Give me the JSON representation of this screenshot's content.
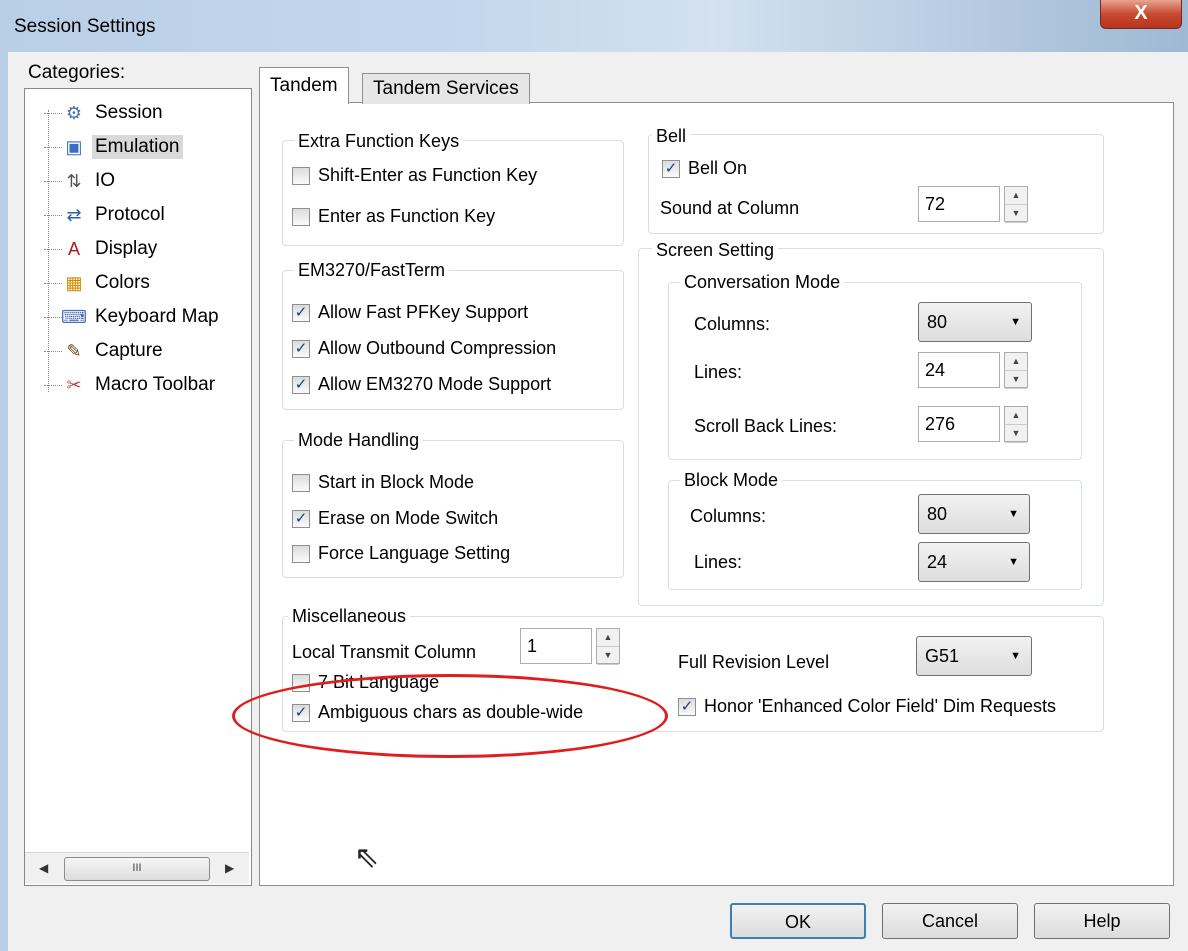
{
  "window": {
    "title": "Session Settings",
    "close_glyph": "X"
  },
  "categories": {
    "label": "Categories:",
    "items": [
      {
        "label": "Session",
        "icon": "session-icon",
        "glyph": "⚙",
        "color": "#4a6fb5"
      },
      {
        "label": "Emulation",
        "icon": "emulation-icon",
        "glyph": "▣",
        "color": "#3a6cc0"
      },
      {
        "label": "IO",
        "icon": "io-icon",
        "glyph": "⇅",
        "color": "#555555"
      },
      {
        "label": "Protocol",
        "icon": "protocol-icon",
        "glyph": "⇄",
        "color": "#2c5fa8"
      },
      {
        "label": "Display",
        "icon": "display-icon",
        "glyph": "A",
        "color": "#b01818"
      },
      {
        "label": "Colors",
        "icon": "colors-icon",
        "glyph": "▦",
        "color": "#d08a00"
      },
      {
        "label": "Keyboard Map",
        "icon": "keyboard-icon",
        "glyph": "⌨",
        "color": "#4a6fb5"
      },
      {
        "label": "Capture",
        "icon": "capture-icon",
        "glyph": "✎",
        "color": "#6b4a1a"
      },
      {
        "label": "Macro Toolbar",
        "icon": "macro-toolbar-icon",
        "glyph": "✂",
        "color": "#c04040"
      }
    ],
    "selected": "Emulation",
    "scroll_thumb": "III"
  },
  "tabs": [
    "Tandem",
    "Tandem Services"
  ],
  "extra_function_keys": {
    "title": "Extra Function Keys",
    "items": [
      {
        "label": "Shift-Enter as Function Key",
        "checked": false
      },
      {
        "label": "Enter as Function Key",
        "checked": false
      }
    ]
  },
  "em3270": {
    "title": "EM3270/FastTerm",
    "items": [
      {
        "label": "Allow Fast PFKey Support",
        "checked": true
      },
      {
        "label": "Allow Outbound Compression",
        "checked": true
      },
      {
        "label": "Allow EM3270 Mode Support",
        "checked": true
      }
    ]
  },
  "mode_handling": {
    "title": "Mode Handling",
    "items": [
      {
        "label": "Start in Block Mode",
        "checked": false
      },
      {
        "label": "Erase on Mode Switch",
        "checked": true
      },
      {
        "label": "Force Language Setting",
        "checked": false
      }
    ]
  },
  "bell": {
    "title": "Bell",
    "bell_on": {
      "label": "Bell On",
      "checked": true
    },
    "sound_at_column_label": "Sound at Column",
    "sound_at_column_value": "72"
  },
  "screen_setting": {
    "title": "Screen Setting",
    "conversation": {
      "title": "Conversation Mode",
      "columns_label": "Columns:",
      "columns_value": "80",
      "lines_label": "Lines:",
      "lines_value": "24",
      "scroll_label": "Scroll Back Lines:",
      "scroll_value": "276"
    },
    "block": {
      "title": "Block Mode",
      "columns_label": "Columns:",
      "columns_value": "80",
      "lines_label": "Lines:",
      "lines_value": "24"
    }
  },
  "misc": {
    "title": "Miscellaneous",
    "local_transmit_label": "Local Transmit Column",
    "local_transmit_value": "1",
    "seven_bit": {
      "label": "7 Bit Language",
      "checked": false
    },
    "ambiguous": {
      "label": "Ambiguous chars as double-wide",
      "checked": true
    },
    "full_revision_label": "Full Revision Level",
    "full_revision_value": "G51",
    "honor": {
      "label": "Honor 'Enhanced Color Field' Dim Requests",
      "checked": true
    }
  },
  "buttons": {
    "ok": "OK",
    "cancel": "Cancel",
    "help": "Help"
  },
  "icons": {
    "check": "✓",
    "caret": "▼",
    "up": "▲",
    "down": "▼",
    "left": "◀",
    "right": "▶",
    "cursor": "⇖"
  },
  "colors": {
    "highlight_ellipse": "#e01c1c"
  }
}
